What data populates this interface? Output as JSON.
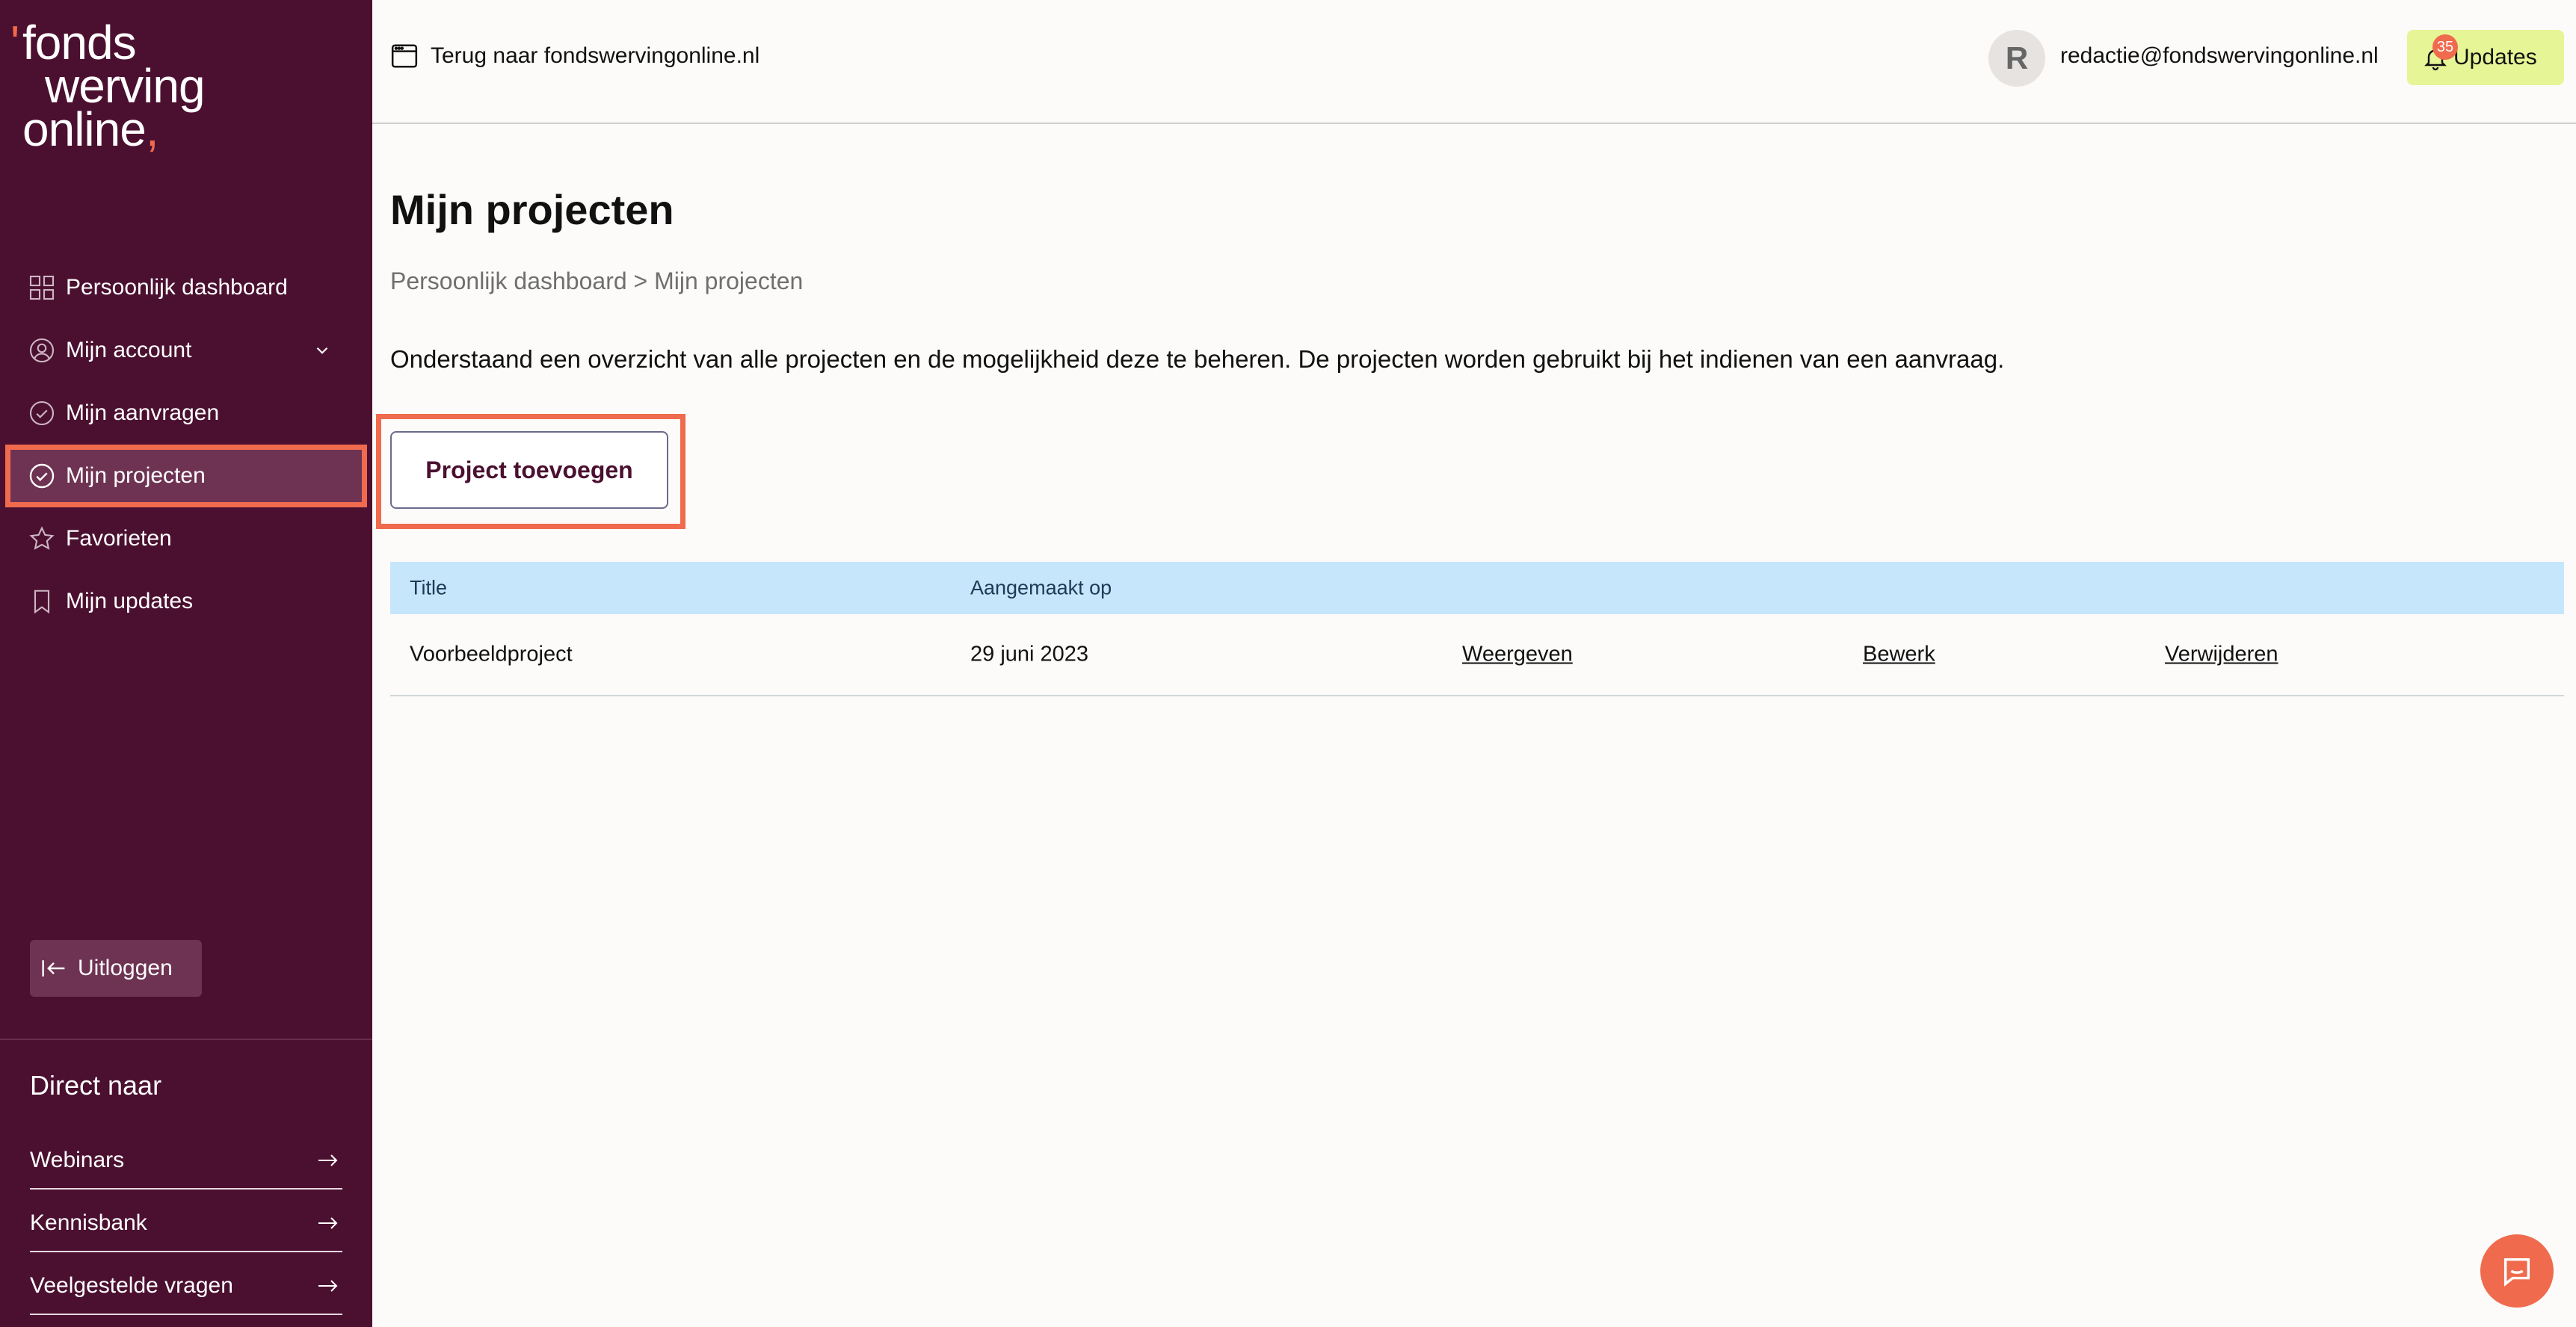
{
  "brand": {
    "logo_line1": "fonds",
    "logo_line2": "werving",
    "logo_line3": "online",
    "accent": "#f06a4e",
    "sidebar_bg": "#4b1030"
  },
  "sidebar": {
    "items": [
      {
        "label": "Persoonlijk dashboard",
        "icon": "grid-icon"
      },
      {
        "label": "Mijn account",
        "icon": "user-circle-icon"
      },
      {
        "label": "Mijn aanvragen",
        "icon": "check-circle-icon"
      },
      {
        "label": "Mijn projecten",
        "icon": "check-circle-icon",
        "active": true
      },
      {
        "label": "Favorieten",
        "icon": "star-icon"
      },
      {
        "label": "Mijn updates",
        "icon": "bookmark-icon"
      }
    ],
    "logout_label": "Uitloggen",
    "direct_title": "Direct naar",
    "direct_links": [
      {
        "label": "Webinars"
      },
      {
        "label": "Kennisbank"
      },
      {
        "label": "Veelgestelde vragen"
      }
    ]
  },
  "topbar": {
    "back_label": "Terug naar fondswervingonline.nl",
    "avatar_initial": "R",
    "user_email": "redactie@fondswervingonline.nl",
    "updates_label": "Updates",
    "updates_count": "35"
  },
  "main": {
    "title": "Mijn projecten",
    "breadcrumb": "Persoonlijk dashboard > Mijn projecten",
    "intro": "Onderstaand een overzicht van alle projecten en de mogelijkheid deze te beheren. De projecten worden gebruikt bij het indienen van een aanvraag.",
    "add_button": "Project toevoegen",
    "table": {
      "headers": [
        "Title",
        "Aangemaakt op"
      ],
      "rows": [
        {
          "title": "Voorbeeldproject",
          "date": "29 juni 2023",
          "view": "Weergeven",
          "edit": "Bewerk",
          "delete": "Verwijderen"
        }
      ]
    }
  }
}
